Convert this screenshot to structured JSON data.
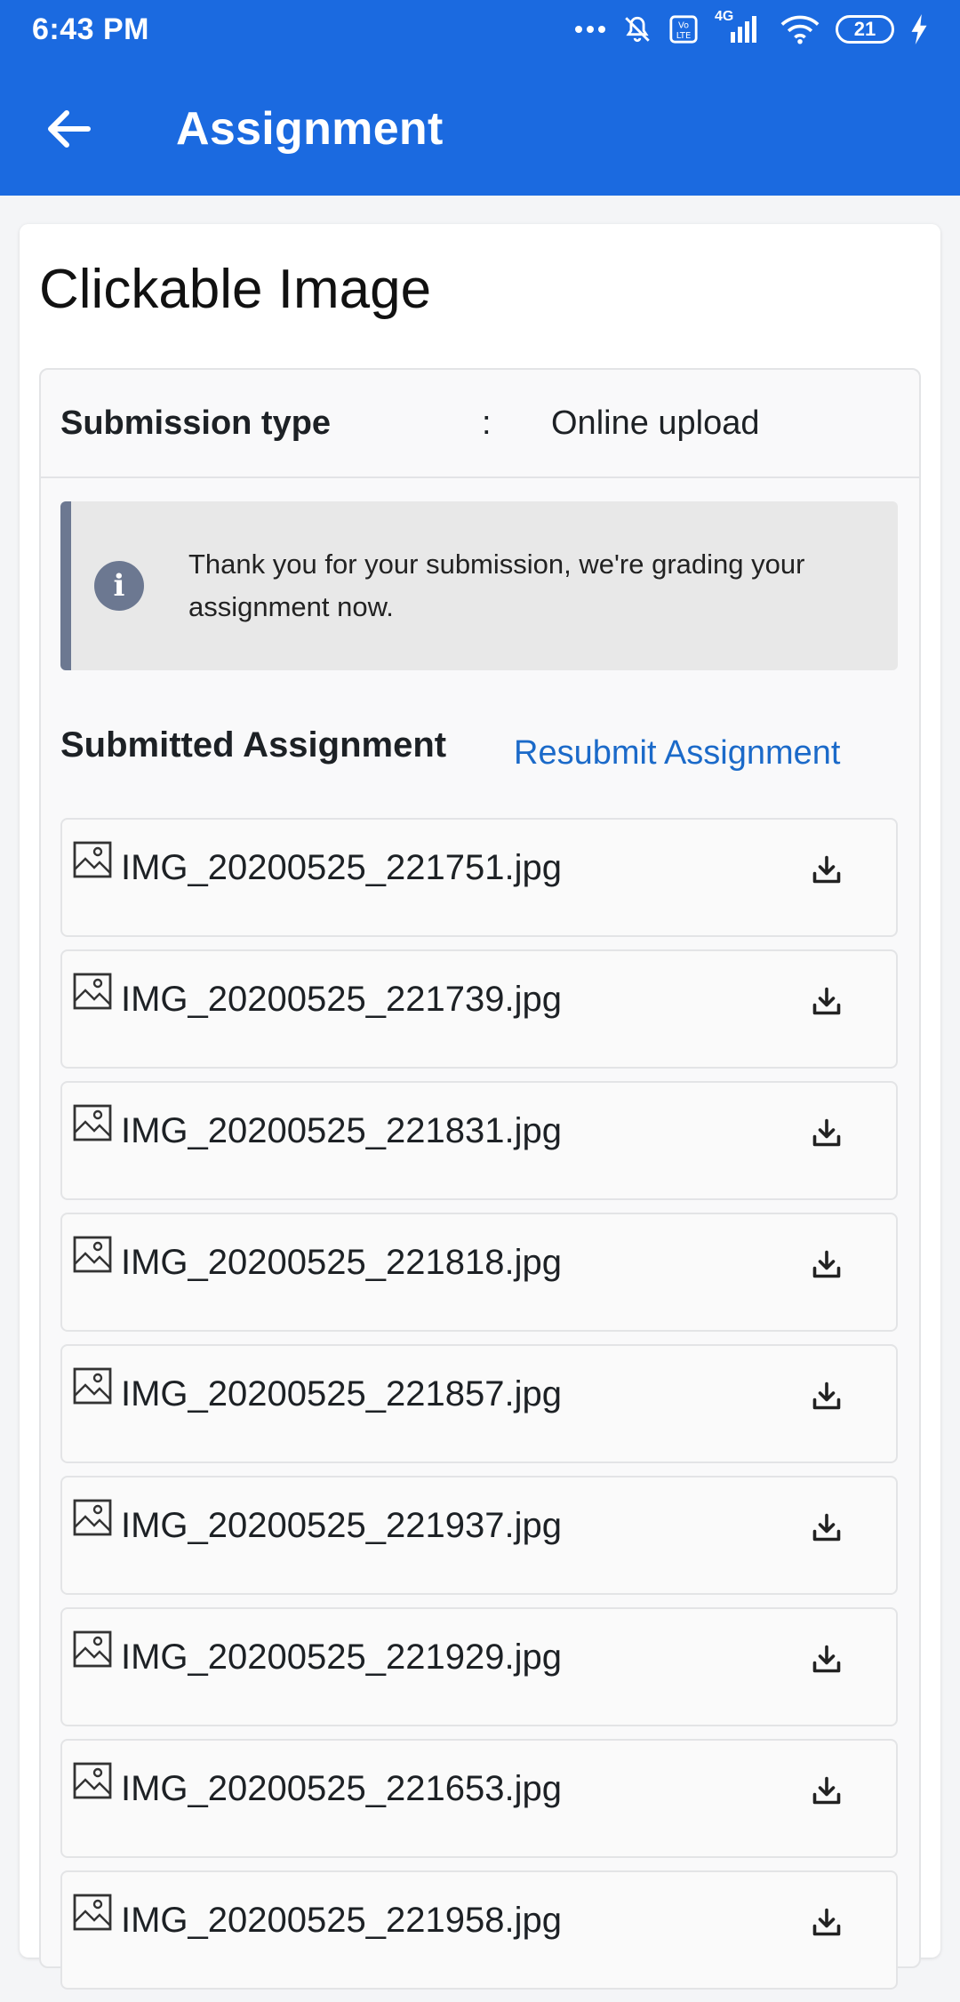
{
  "status_bar": {
    "time": "6:43 PM",
    "battery": "21",
    "network": "4G",
    "icons": [
      "more-dots-icon",
      "mute-bell-icon",
      "volte-icon",
      "signal-icon",
      "wifi-icon",
      "battery-icon",
      "charging-icon"
    ]
  },
  "header": {
    "title": "Assignment",
    "back_icon": "arrow-left-icon",
    "background": "#1b6ae0"
  },
  "card": {
    "title": "Clickable Image"
  },
  "submission": {
    "label": "Submission type",
    "separator": ":",
    "value": "Online upload"
  },
  "alert": {
    "icon": "info-icon",
    "text": "Thank you for your submission, we're grading your assignment now."
  },
  "submitted": {
    "title": "Submitted Assignment",
    "resubmit_label": "Resubmit Assignment",
    "files": [
      {
        "name": "IMG_20200525_221751.jpg"
      },
      {
        "name": "IMG_20200525_221739.jpg"
      },
      {
        "name": "IMG_20200525_221831.jpg"
      },
      {
        "name": "IMG_20200525_221818.jpg"
      },
      {
        "name": "IMG_20200525_221857.jpg"
      },
      {
        "name": "IMG_20200525_221937.jpg"
      },
      {
        "name": "IMG_20200525_221929.jpg"
      },
      {
        "name": "IMG_20200525_221653.jpg"
      },
      {
        "name": "IMG_20200525_221958.jpg"
      }
    ]
  }
}
